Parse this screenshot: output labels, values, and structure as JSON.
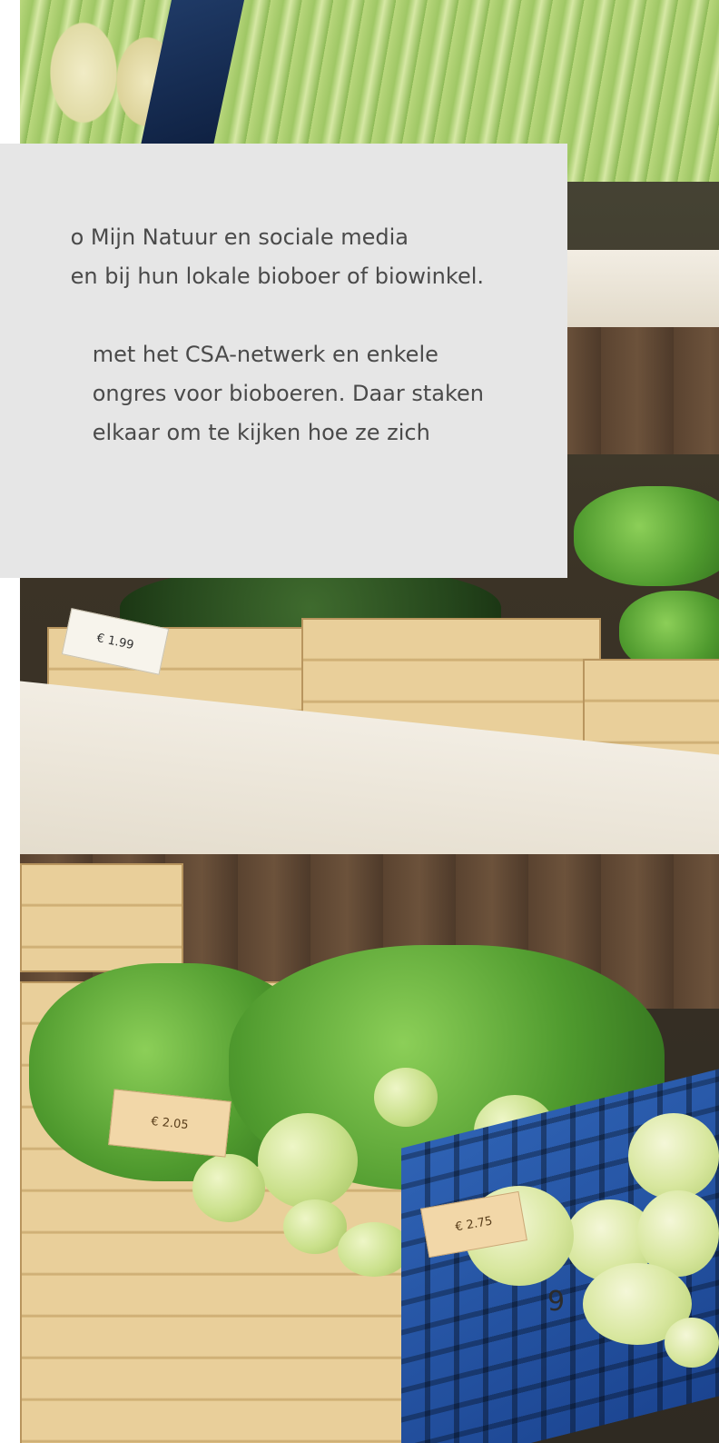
{
  "photo": {
    "price_tags": [
      "€ 1.99",
      "€ 2.05",
      "€ 2.75"
    ]
  },
  "text_panel": {
    "paragraph_1": [
      "o Mijn Natuur en sociale media",
      "en bij hun lokale bioboer of biowinkel."
    ],
    "paragraph_2": [
      "met het CSA-netwerk en enkele",
      "ongres voor bioboeren. Daar staken",
      " elkaar om te kijken hoe ze zich"
    ]
  },
  "page_number": "9"
}
